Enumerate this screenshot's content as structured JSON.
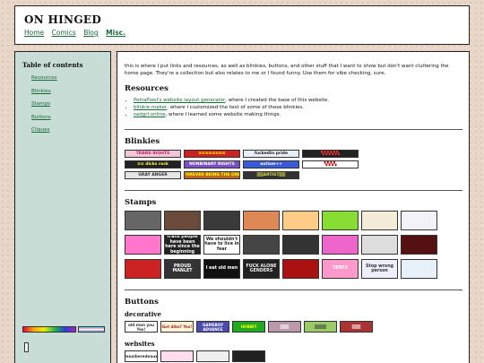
{
  "site": {
    "title": "ON HINGED",
    "nav": [
      "Home",
      "Comics",
      "Blog",
      "Misc."
    ]
  },
  "sidebar": {
    "toc_title": "Table of contents",
    "items": [
      "Resources",
      "Blinkies",
      "Stamps",
      "Buttons",
      "Cliques"
    ]
  },
  "main": {
    "intro": "this is where I put links and resources, as well as blinkies, buttons, and other stuff that I want to show but don't want cluttering the home page. They're a collection but also relates to me or I found funny. Use them for vibe checking, sure.",
    "resources": {
      "heading": "Resources",
      "items": [
        {
          "link": "PetraPixel's website layout generator",
          "rest": ", where I created the base of this website."
        },
        {
          "link": "blinkie maker",
          "rest": ", where I customized the text of some of those blinkies."
        },
        {
          "link": "sadgrl.online",
          "rest": ", where I learned some website making things."
        }
      ]
    },
    "blinkies_heading": "Blinkies",
    "blinkies": [
      {
        "text": "TRANS RIGHTS",
        "bg": "#f3c6d6",
        "fg": "#c0246b"
      },
      {
        "text": "≡≡≡≡≡≡≡≡",
        "bg": "#c22",
        "fg": "#ff0"
      },
      {
        "text": "fuckedtn pride",
        "bg": "#e8eef8",
        "fg": "#222"
      },
      {
        "text": "▚▚▚▚▚▚",
        "bg": "#222",
        "fg": "#f33"
      },
      {
        "text": "≡≡ dicks rock",
        "bg": "#222",
        "fg": "#ff4"
      },
      {
        "text": "NONBINARY RIGHTS",
        "bg": "#7a4fc9",
        "fg": "#fff"
      },
      {
        "text": "autism++",
        "bg": "#3a5ad8",
        "fg": "#fff"
      },
      {
        "text": "▚▚▚▚",
        "bg": "#fff",
        "fg": "#c00"
      },
      {
        "text": "GRAY ANGER",
        "bg": "#e5e5e5",
        "fg": "#333"
      },
      {
        "text": "FOREVER BEING THE ONE",
        "bg": "#b62",
        "fg": "#ff0"
      },
      {
        "text": "▒▒ARTIST▒▒",
        "bg": "#333",
        "fg": "#dd4"
      }
    ],
    "stamps_heading": "Stamps",
    "stamps": [
      {
        "text": "",
        "bg": "#666",
        "fg": "#fff"
      },
      {
        "text": "",
        "bg": "#6a4a3a",
        "fg": "#fff"
      },
      {
        "text": "",
        "bg": "#3a3a3a",
        "fg": "#fff"
      },
      {
        "text": "",
        "bg": "#d85",
        "fg": "#fff"
      },
      {
        "text": "",
        "bg": "#fc8",
        "fg": "#333"
      },
      {
        "text": "",
        "bg": "#8d3",
        "fg": "#fff"
      },
      {
        "text": "",
        "bg": "#f4ecd8",
        "fg": "#333"
      },
      {
        "text": "",
        "bg": "#f2f2f8",
        "fg": "#333"
      },
      {
        "text": "",
        "bg": "#f7c",
        "fg": "#fff"
      },
      {
        "text": "trans people have been here since the beginning",
        "bg": "#222",
        "fg": "#fff"
      },
      {
        "text": "We shouldn't have to live in fear",
        "bg": "#fff",
        "fg": "#222"
      },
      {
        "text": "",
        "bg": "#454545",
        "fg": "#fff"
      },
      {
        "text": "",
        "bg": "#333",
        "fg": "#fff"
      },
      {
        "text": "",
        "bg": "#e6c",
        "fg": "#fff"
      },
      {
        "text": "",
        "bg": "#ddd",
        "fg": "#333"
      },
      {
        "text": "",
        "bg": "#511",
        "fg": "#fff"
      },
      {
        "text": "",
        "bg": "#c22",
        "fg": "#fff"
      },
      {
        "text": "PROUD MANLET",
        "bg": "#333",
        "fg": "#fff"
      },
      {
        "text": "I eat old men",
        "bg": "#111",
        "fg": "#fff"
      },
      {
        "text": "FUCK ALONE GENDERS",
        "bg": "#222",
        "fg": "#eee"
      },
      {
        "text": "",
        "bg": "#a11",
        "fg": "#fff"
      },
      {
        "text": "TERFS",
        "bg": "#f9c",
        "fg": "#fff"
      },
      {
        "text": "Stop wrong person",
        "bg": "#eef",
        "fg": "#333"
      },
      {
        "text": "",
        "bg": "#e8f0fa",
        "fg": "#333"
      }
    ],
    "buttons_heading": "Buttons",
    "decorative_heading": "decorative",
    "decorative": [
      {
        "text": "old man you Yes!",
        "bg": "#fff",
        "fg": "#333"
      },
      {
        "text": "Got dibs? Yes!",
        "bg": "#fff4d8",
        "fg": "#a22"
      },
      {
        "text": "GAMEBOY ADVANCE",
        "bg": "#4b4bb0",
        "fg": "#fff"
      },
      {
        "text": "HOBBIT",
        "bg": "#2a2",
        "fg": "#ff0"
      },
      {
        "text": "▒▒▒",
        "bg": "#b9a",
        "fg": "#fff"
      },
      {
        "text": "▒▒▒▒",
        "bg": "#9c6",
        "fg": "#333"
      },
      {
        "text": "▒▒▒",
        "bg": "#a33",
        "fg": "#fff"
      }
    ],
    "websites_heading": "websites",
    "websites": [
      {
        "text": "mouiberedeaux",
        "bg": "#fff",
        "fg": "#333"
      },
      {
        "text": "",
        "bg": "#fde",
        "fg": "#333"
      },
      {
        "text": "",
        "bg": "#eee",
        "fg": "#333"
      },
      {
        "text": "",
        "bg": "#222",
        "fg": "#fff"
      }
    ]
  },
  "colors": {
    "link": "#1a6b3a",
    "sidebar_bg": "#c7ddd6",
    "page_bg": "#e8d6c8"
  }
}
